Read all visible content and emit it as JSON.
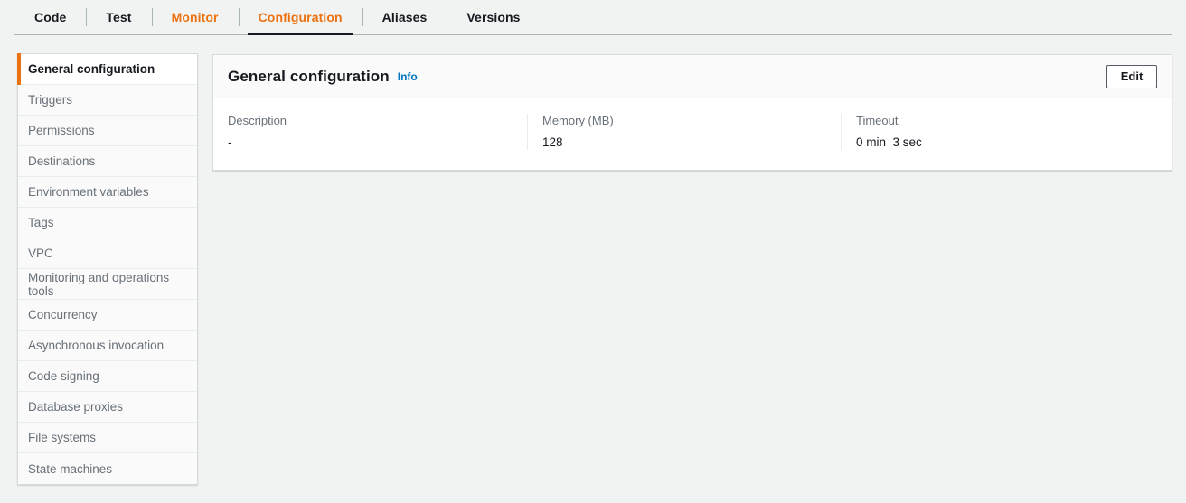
{
  "tabs": [
    {
      "label": "Code",
      "accent": false,
      "active": false
    },
    {
      "label": "Test",
      "accent": false,
      "active": false
    },
    {
      "label": "Monitor",
      "accent": true,
      "active": false
    },
    {
      "label": "Configuration",
      "accent": true,
      "active": true
    },
    {
      "label": "Aliases",
      "accent": false,
      "active": false
    },
    {
      "label": "Versions",
      "accent": false,
      "active": false
    }
  ],
  "sidebar": {
    "items": [
      {
        "label": "General configuration",
        "selected": true
      },
      {
        "label": "Triggers",
        "selected": false
      },
      {
        "label": "Permissions",
        "selected": false
      },
      {
        "label": "Destinations",
        "selected": false
      },
      {
        "label": "Environment variables",
        "selected": false
      },
      {
        "label": "Tags",
        "selected": false
      },
      {
        "label": "VPC",
        "selected": false
      },
      {
        "label": "Monitoring and operations tools",
        "selected": false
      },
      {
        "label": "Concurrency",
        "selected": false
      },
      {
        "label": "Asynchronous invocation",
        "selected": false
      },
      {
        "label": "Code signing",
        "selected": false
      },
      {
        "label": "Database proxies",
        "selected": false
      },
      {
        "label": "File systems",
        "selected": false
      },
      {
        "label": "State machines",
        "selected": false
      }
    ]
  },
  "card": {
    "title": "General configuration",
    "info_label": "Info",
    "edit_label": "Edit",
    "fields": [
      {
        "label": "Description",
        "value": "-"
      },
      {
        "label": "Memory (MB)",
        "value": "128"
      },
      {
        "label": "Timeout",
        "value": "0 min  3 sec"
      }
    ]
  },
  "colors": {
    "accent_orange": "#ec7211",
    "link_blue": "#0073bb",
    "text_dark": "#16191f",
    "text_muted": "#687078",
    "page_bg": "#f1f3f3",
    "border": "#d5dbdb"
  }
}
